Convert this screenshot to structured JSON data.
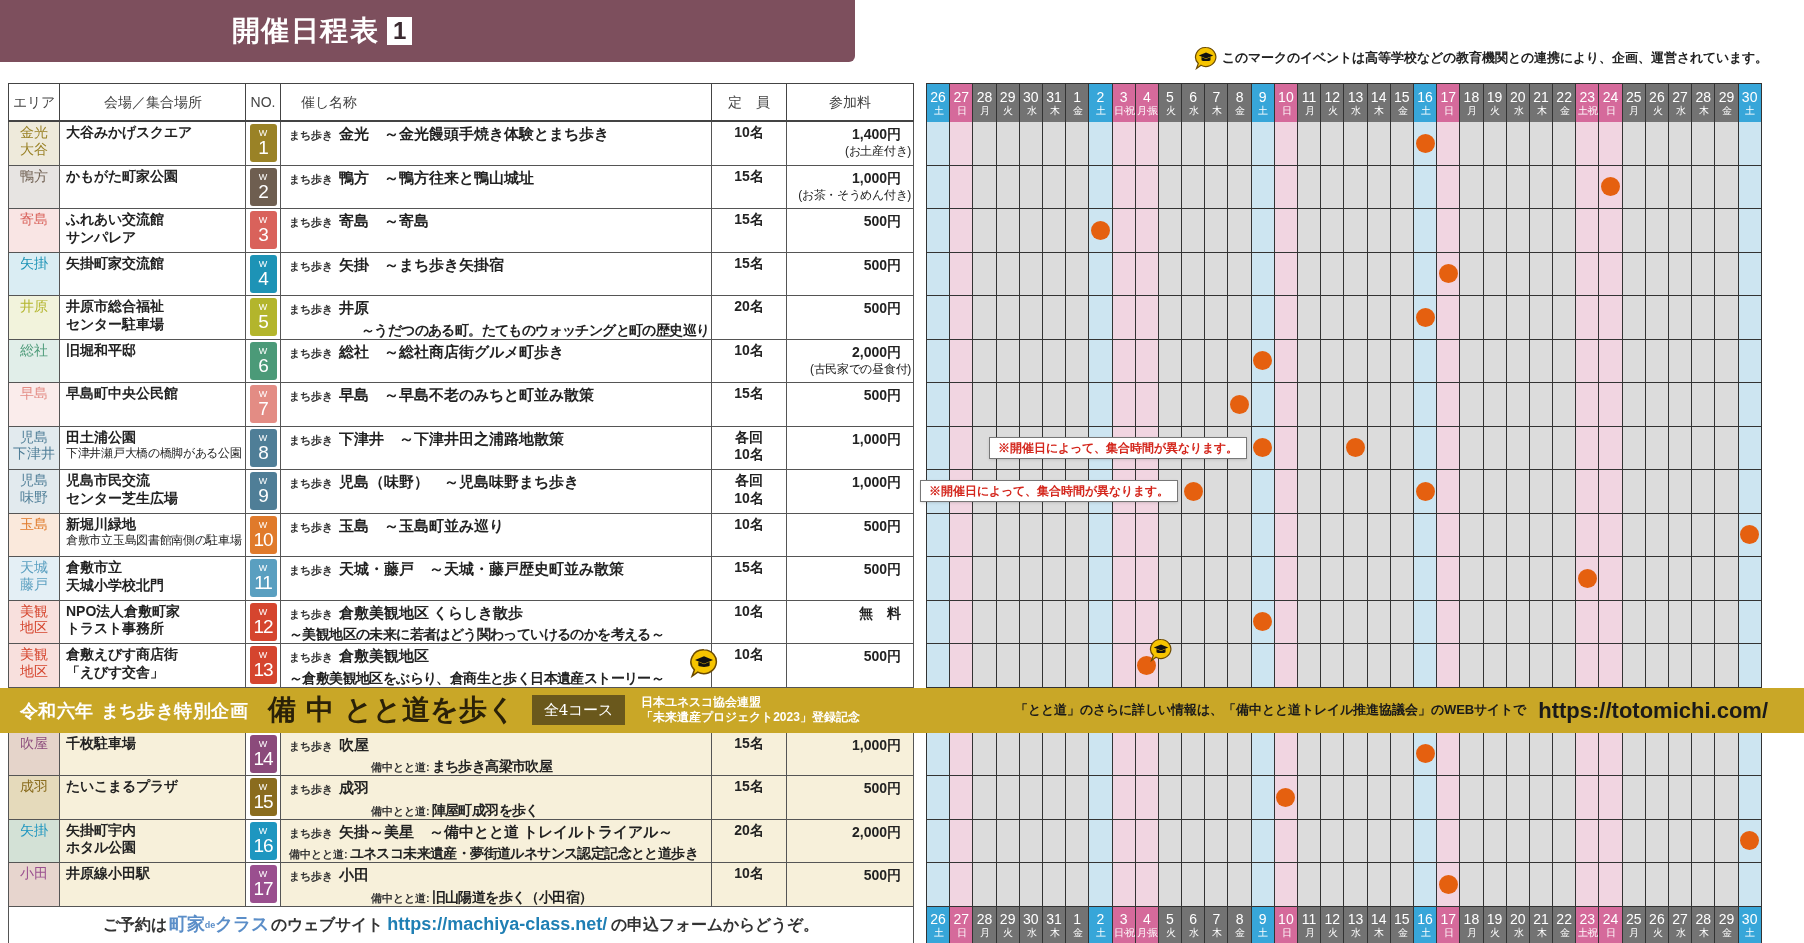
{
  "title": {
    "text": "開催日程表",
    "number": "1"
  },
  "legend": {
    "text": "このマークのイベントは高等学校などの教育機関との連携により、企画、運営されています。"
  },
  "table": {
    "columns": [
      "エリア",
      "会場／集合場所",
      "NO.",
      "催し名称",
      "定　員",
      "参加料"
    ],
    "days": [
      {
        "day": "26",
        "weekday": "土",
        "kind": "saturday"
      },
      {
        "day": "27",
        "weekday": "日",
        "kind": "holiday"
      },
      {
        "day": "28",
        "weekday": "月",
        "kind": "weekday"
      },
      {
        "day": "29",
        "weekday": "火",
        "kind": "weekday"
      },
      {
        "day": "30",
        "weekday": "水",
        "kind": "weekday"
      },
      {
        "day": "31",
        "weekday": "木",
        "kind": "weekday"
      },
      {
        "day": "1",
        "weekday": "金",
        "kind": "weekday"
      },
      {
        "day": "2",
        "weekday": "土",
        "kind": "saturday"
      },
      {
        "day": "3",
        "weekday": "日·祝",
        "kind": "holiday"
      },
      {
        "day": "4",
        "weekday": "月·振",
        "kind": "holiday"
      },
      {
        "day": "5",
        "weekday": "火",
        "kind": "weekday"
      },
      {
        "day": "6",
        "weekday": "水",
        "kind": "weekday"
      },
      {
        "day": "7",
        "weekday": "木",
        "kind": "weekday"
      },
      {
        "day": "8",
        "weekday": "金",
        "kind": "weekday"
      },
      {
        "day": "9",
        "weekday": "土",
        "kind": "saturday"
      },
      {
        "day": "10",
        "weekday": "日",
        "kind": "holiday"
      },
      {
        "day": "11",
        "weekday": "月",
        "kind": "weekday"
      },
      {
        "day": "12",
        "weekday": "火",
        "kind": "weekday"
      },
      {
        "day": "13",
        "weekday": "水",
        "kind": "weekday"
      },
      {
        "day": "14",
        "weekday": "木",
        "kind": "weekday"
      },
      {
        "day": "15",
        "weekday": "金",
        "kind": "weekday"
      },
      {
        "day": "16",
        "weekday": "土",
        "kind": "saturday"
      },
      {
        "day": "17",
        "weekday": "日",
        "kind": "holiday"
      },
      {
        "day": "18",
        "weekday": "月",
        "kind": "weekday"
      },
      {
        "day": "19",
        "weekday": "火",
        "kind": "weekday"
      },
      {
        "day": "20",
        "weekday": "水",
        "kind": "weekday"
      },
      {
        "day": "21",
        "weekday": "木",
        "kind": "weekday"
      },
      {
        "day": "22",
        "weekday": "金",
        "kind": "weekday"
      },
      {
        "day": "23",
        "weekday": "土·祝",
        "kind": "holiday"
      },
      {
        "day": "24",
        "weekday": "日",
        "kind": "holiday"
      },
      {
        "day": "25",
        "weekday": "月",
        "kind": "weekday"
      },
      {
        "day": "26",
        "weekday": "火",
        "kind": "weekday"
      },
      {
        "day": "27",
        "weekday": "水",
        "kind": "weekday"
      },
      {
        "day": "28",
        "weekday": "木",
        "kind": "weekday"
      },
      {
        "day": "29",
        "weekday": "金",
        "kind": "weekday"
      },
      {
        "day": "30",
        "weekday": "土",
        "kind": "saturday"
      }
    ],
    "footer_days": [
      {
        "day": "26",
        "weekday": "土",
        "kind": "saturday"
      },
      {
        "day": "27",
        "weekday": "日",
        "kind": "holiday"
      },
      {
        "day": "28",
        "weekday": "月",
        "kind": "weekday"
      },
      {
        "day": "29",
        "weekday": "火",
        "kind": "weekday"
      },
      {
        "day": "30",
        "weekday": "水",
        "kind": "weekday"
      },
      {
        "day": "31",
        "weekday": "木",
        "kind": "weekday"
      },
      {
        "day": "1",
        "weekday": "金",
        "kind": "weekday"
      },
      {
        "day": "2",
        "weekday": "土",
        "kind": "saturday"
      },
      {
        "day": "3",
        "weekday": "日·祝",
        "kind": "holiday"
      },
      {
        "day": "4",
        "weekday": "月·振",
        "kind": "holiday"
      },
      {
        "day": "5",
        "weekday": "火",
        "kind": "weekday"
      },
      {
        "day": "6",
        "weekday": "水",
        "kind": "weekday"
      },
      {
        "day": "7",
        "weekday": "木",
        "kind": "weekday"
      },
      {
        "day": "8",
        "weekday": "金",
        "kind": "weekday"
      },
      {
        "day": "9",
        "weekday": "土",
        "kind": "saturday"
      },
      {
        "day": "10",
        "weekday": "日",
        "kind": "holiday"
      },
      {
        "day": "11",
        "weekday": "月",
        "kind": "weekday"
      },
      {
        "day": "12",
        "weekday": "火",
        "kind": "weekday"
      },
      {
        "day": "13",
        "weekday": "水",
        "kind": "weekday"
      },
      {
        "day": "14",
        "weekday": "木",
        "kind": "weekday"
      },
      {
        "day": "15",
        "weekday": "金",
        "kind": "weekday"
      },
      {
        "day": "16",
        "weekday": "土",
        "kind": "saturday"
      },
      {
        "day": "17",
        "weekday": "日",
        "kind": "holiday"
      },
      {
        "day": "18",
        "weekday": "月",
        "kind": "weekday"
      },
      {
        "day": "19",
        "weekday": "火",
        "kind": "weekday"
      },
      {
        "day": "20",
        "weekday": "水",
        "kind": "weekday"
      },
      {
        "day": "21",
        "weekday": "木",
        "kind": "weekday"
      },
      {
        "day": "22",
        "weekday": "金",
        "kind": "weekday"
      },
      {
        "day": "23",
        "weekday": "土·祝",
        "kind": "holiday"
      },
      {
        "day": "24",
        "weekday": "日",
        "kind": "holiday"
      },
      {
        "day": "25",
        "weekday": "月",
        "kind": "weekday"
      },
      {
        "day": "26",
        "weekday": "火",
        "kind": "weekday"
      },
      {
        "day": "27",
        "weekday": "水",
        "kind": "weekday"
      },
      {
        "day": "28",
        "weekday": "木",
        "kind": "weekday"
      },
      {
        "day": "29",
        "weekday": "金",
        "kind": "weekday"
      },
      {
        "day": "30",
        "weekday": "土",
        "kind": "saturday"
      }
    ],
    "rows": [
      {
        "area": [
          "金光",
          "大谷"
        ],
        "color": "#9a8226",
        "venue": [
          "大谷みかげスクエア"
        ],
        "badge_letter": "W",
        "no": "1",
        "prefix": "まち歩き",
        "title": "金光　～金光饅頭手焼き体験とまち歩き",
        "capacity": [
          "10名"
        ],
        "fee": "1,400円",
        "fee_note": "(お土産付き)",
        "calendar": [
          false,
          false,
          false,
          false,
          false,
          false,
          false,
          false,
          false,
          false,
          false,
          false,
          false,
          false,
          false,
          false,
          false,
          false,
          false,
          false,
          false,
          true,
          false,
          false,
          false,
          false,
          false,
          false,
          false,
          false,
          false,
          false,
          false,
          false,
          false,
          false
        ]
      },
      {
        "area": [
          "鴨方"
        ],
        "color": "#6e5e50",
        "venue": [
          "かもがた町家公園"
        ],
        "badge_letter": "W",
        "no": "2",
        "prefix": "まち歩き",
        "title": "鴨方　～鴨方往来と鴨山城址",
        "capacity": [
          "15名"
        ],
        "fee": "1,000円",
        "fee_note": "(お茶・そうめん付き)",
        "calendar": [
          false,
          false,
          false,
          false,
          false,
          false,
          false,
          false,
          false,
          false,
          false,
          false,
          false,
          false,
          false,
          false,
          false,
          false,
          false,
          false,
          false,
          false,
          false,
          false,
          false,
          false,
          false,
          false,
          false,
          true,
          false,
          false,
          false,
          false,
          false,
          false
        ]
      },
      {
        "area": [
          "寄島"
        ],
        "color": "#d9625b",
        "venue": [
          "ふれあい交流館",
          "サンパレア"
        ],
        "badge_letter": "W",
        "no": "3",
        "prefix": "まち歩き",
        "title": "寄島　～寄島",
        "capacity": [
          "15名"
        ],
        "fee": "500円",
        "calendar": [
          false,
          false,
          false,
          false,
          false,
          false,
          false,
          true,
          false,
          false,
          false,
          false,
          false,
          false,
          false,
          false,
          false,
          false,
          false,
          false,
          false,
          false,
          false,
          false,
          false,
          false,
          false,
          false,
          false,
          false,
          false,
          false,
          false,
          false,
          false,
          false
        ]
      },
      {
        "area": [
          "矢掛"
        ],
        "color": "#1d93b6",
        "venue": [
          "矢掛町家交流館"
        ],
        "badge_letter": "W",
        "no": "4",
        "prefix": "まち歩き",
        "title": "矢掛　～まち歩き矢掛宿",
        "capacity": [
          "15名"
        ],
        "fee": "500円",
        "calendar": [
          false,
          false,
          false,
          false,
          false,
          false,
          false,
          false,
          false,
          false,
          false,
          false,
          false,
          false,
          false,
          false,
          false,
          false,
          false,
          false,
          false,
          false,
          true,
          false,
          false,
          false,
          false,
          false,
          false,
          false,
          false,
          false,
          false,
          false,
          false,
          false
        ]
      },
      {
        "area": [
          "井原"
        ],
        "color": "#b3b52c",
        "venue": [
          "井原市総合福祉",
          "センター駐車場"
        ],
        "badge_letter": "W",
        "no": "5",
        "prefix": "まち歩き",
        "title": "井原",
        "line2": "～うだつのある町。たてものウォッチングと町の歴史巡り",
        "line2_indent": true,
        "capacity": [
          "20名"
        ],
        "fee": "500円",
        "calendar": [
          false,
          false,
          false,
          false,
          false,
          false,
          false,
          false,
          false,
          false,
          false,
          false,
          false,
          false,
          false,
          false,
          false,
          false,
          false,
          false,
          false,
          true,
          false,
          false,
          false,
          false,
          false,
          false,
          false,
          false,
          false,
          false,
          false,
          false,
          false,
          false
        ]
      },
      {
        "area": [
          "総社"
        ],
        "color": "#4b9a78",
        "venue": [
          "旧堀和平邸"
        ],
        "badge_letter": "W",
        "no": "6",
        "prefix": "まち歩き",
        "title": "総社　～総社商店街グルメ町歩き",
        "capacity": [
          "10名"
        ],
        "fee": "2,000円",
        "fee_note": "(古民家での昼食付)",
        "calendar": [
          false,
          false,
          false,
          false,
          false,
          false,
          false,
          false,
          false,
          false,
          false,
          false,
          false,
          false,
          true,
          false,
          false,
          false,
          false,
          false,
          false,
          false,
          false,
          false,
          false,
          false,
          false,
          false,
          false,
          false,
          false,
          false,
          false,
          false,
          false,
          false
        ]
      },
      {
        "area": [
          "早島"
        ],
        "color": "#e38c84",
        "venue": [
          "早島町中央公民館"
        ],
        "badge_letter": "W",
        "no": "7",
        "prefix": "まち歩き",
        "title": "早島　～早島不老のみちと町並み散策",
        "capacity": [
          "15名"
        ],
        "fee": "500円",
        "calendar": [
          false,
          false,
          false,
          false,
          false,
          false,
          false,
          false,
          false,
          false,
          false,
          false,
          false,
          true,
          false,
          false,
          false,
          false,
          false,
          false,
          false,
          false,
          false,
          false,
          false,
          false,
          false,
          false,
          false,
          false,
          false,
          false,
          false,
          false,
          false,
          false
        ]
      },
      {
        "area": [
          "児島",
          "下津井"
        ],
        "color": "#4f7e97",
        "venue": [
          "田土浦公園"
        ],
        "venue_note": "下津井瀬戸大橋の橋脚がある公園",
        "badge_letter": "W",
        "no": "8",
        "prefix": "まち歩き",
        "title": "下津井　～下津井田之浦路地散策",
        "capacity": [
          "各回",
          "10名"
        ],
        "fee": "1,000円",
        "note": "※開催日によって、集合時間が異なります。",
        "calendar": [
          false,
          false,
          false,
          false,
          false,
          false,
          false,
          false,
          false,
          false,
          false,
          false,
          false,
          false,
          true,
          false,
          false,
          false,
          true,
          false,
          false,
          false,
          false,
          false,
          false,
          false,
          false,
          false,
          false,
          false,
          false,
          false,
          false,
          false,
          false,
          false
        ]
      },
      {
        "area": [
          "児島",
          "味野"
        ],
        "color": "#4f7e97",
        "venue": [
          "児島市民交流",
          "センター芝生広場"
        ],
        "badge_letter": "W",
        "no": "9",
        "prefix": "まち歩き",
        "title": "児島（味野）　～児島味野まち歩き",
        "capacity": [
          "各回",
          "10名"
        ],
        "fee": "1,000円",
        "note": "※開催日によって、集合時間が異なります。",
        "calendar": [
          false,
          false,
          false,
          false,
          false,
          false,
          false,
          false,
          false,
          false,
          false,
          true,
          false,
          false,
          false,
          false,
          false,
          false,
          false,
          false,
          false,
          true,
          false,
          false,
          false,
          false,
          false,
          false,
          false,
          false,
          false,
          false,
          false,
          false,
          false,
          false
        ]
      },
      {
        "area": [
          "玉島"
        ],
        "color": "#e07a2b",
        "venue": [
          "新堀川緑地"
        ],
        "venue_note": "倉敷市立玉島図書館南側の駐車場",
        "badge_letter": "W",
        "no": "10",
        "prefix": "まち歩き",
        "title": "玉島　～玉島町並み巡り",
        "capacity": [
          "10名"
        ],
        "fee": "500円",
        "calendar": [
          false,
          false,
          false,
          false,
          false,
          false,
          false,
          false,
          false,
          false,
          false,
          false,
          false,
          false,
          false,
          false,
          false,
          false,
          false,
          false,
          false,
          false,
          false,
          false,
          false,
          false,
          false,
          false,
          false,
          false,
          false,
          false,
          false,
          false,
          false,
          true
        ]
      },
      {
        "area": [
          "天城",
          "藤戸"
        ],
        "color": "#5a9fc0",
        "venue": [
          "倉敷市立",
          "天城小学校北門"
        ],
        "badge_letter": "W",
        "no": "11",
        "prefix": "まち歩き",
        "title": "天城・藤戸　～天城・藤戸歴史町並み散策",
        "capacity": [
          "15名"
        ],
        "fee": "500円",
        "calendar": [
          false,
          false,
          false,
          false,
          false,
          false,
          false,
          false,
          false,
          false,
          false,
          false,
          false,
          false,
          false,
          false,
          false,
          false,
          false,
          false,
          false,
          false,
          false,
          false,
          false,
          false,
          false,
          false,
          true,
          false,
          false,
          false,
          false,
          false,
          false,
          false
        ]
      },
      {
        "area": [
          "美観",
          "地区"
        ],
        "color": "#d5452e",
        "venue": [
          "NPO法人倉敷町家",
          "トラスト事務所"
        ],
        "badge_letter": "W",
        "no": "12",
        "prefix": "まち歩き",
        "title": "倉敷美観地区 くらしき散歩",
        "line2": "～美観地区の未来に若者はどう関わっていけるのかを考える～",
        "line2_indent": false,
        "capacity": [
          "10名"
        ],
        "fee": "無　料",
        "calendar": [
          false,
          false,
          false,
          false,
          false,
          false,
          false,
          false,
          false,
          false,
          false,
          false,
          false,
          false,
          true,
          false,
          false,
          false,
          false,
          false,
          false,
          false,
          false,
          false,
          false,
          false,
          false,
          false,
          false,
          false,
          false,
          false,
          false,
          false,
          false,
          false
        ]
      },
      {
        "area": [
          "美観",
          "地区"
        ],
        "color": "#d5452e",
        "venue": [
          "倉敷えびす商店街",
          "「えびす交舎」"
        ],
        "badge_letter": "W",
        "no": "13",
        "prefix": "まち歩き",
        "title": "倉敷美観地区",
        "line2": "～倉敷美観地区をぶらり、倉商生と歩く日本遺産ストーリー～",
        "line2_indent": false,
        "school": true,
        "capacity": [
          "10名"
        ],
        "fee": "500円",
        "calendar": [
          false,
          false,
          false,
          false,
          false,
          false,
          false,
          false,
          false,
          true,
          false,
          false,
          false,
          false,
          false,
          false,
          false,
          false,
          false,
          false,
          false,
          false,
          false,
          false,
          false,
          false,
          false,
          false,
          false,
          false,
          false,
          false,
          false,
          false,
          false,
          false
        ]
      }
    ],
    "banner": {
      "lead": "令和六年 まち歩き特別企画",
      "title": "備 中 とと道を歩く",
      "badge": "全4コース",
      "note": [
        "日本ユネスコ協会連盟",
        "「未来遺産プロジェクト2023」登録記念"
      ],
      "info": "「とと道」のさらに詳しい情報は、「備中とと道トレイル推進協議会」のWEBサイトで",
      "url": "https://totomichi.com/"
    },
    "special_rows": [
      {
        "area": [
          "吹屋"
        ],
        "color": "#8b4a7b",
        "venue": [
          "千枚駐車場"
        ],
        "badge_letter": "W",
        "no": "14",
        "prefix": "まち歩き",
        "title": "吹屋",
        "line2_prefix": "備中とと道:",
        "line2": "まち歩き高梁市吹屋",
        "line2_indent": true,
        "capacity": [
          "15名"
        ],
        "fee": "1,000円",
        "calendar": [
          false,
          false,
          false,
          false,
          false,
          false,
          false,
          false,
          false,
          false,
          false,
          false,
          false,
          false,
          false,
          false,
          false,
          false,
          false,
          false,
          false,
          true,
          false,
          false,
          false,
          false,
          false,
          false,
          false,
          false,
          false,
          false,
          false,
          false,
          false,
          false
        ]
      },
      {
        "area": [
          "成羽"
        ],
        "color": "#8a6c1e",
        "venue": [
          "たいこまるプラザ"
        ],
        "badge_letter": "W",
        "no": "15",
        "prefix": "まち歩き",
        "title": "成羽",
        "line2_prefix": "備中とと道:",
        "line2": "陣屋町成羽を歩く",
        "line2_indent": true,
        "capacity": [
          "15名"
        ],
        "fee": "500円",
        "calendar": [
          false,
          false,
          false,
          false,
          false,
          false,
          false,
          false,
          false,
          false,
          false,
          false,
          false,
          false,
          false,
          true,
          false,
          false,
          false,
          false,
          false,
          false,
          false,
          false,
          false,
          false,
          false,
          false,
          false,
          false,
          false,
          false,
          false,
          false,
          false,
          false
        ]
      },
      {
        "area": [
          "矢掛"
        ],
        "color": "#1e96c0",
        "venue": [
          "矢掛町宇内",
          "ホタル公園"
        ],
        "badge_letter": "W",
        "no": "16",
        "prefix": "まち歩き",
        "title": "矢掛～美星　～備中とと道 トレイルトライアル～",
        "line2_prefix": "備中とと道:",
        "line2": "ユネスコ未来遺産・夢街道ルネサンス認定記念とと道歩き",
        "line2_indent": false,
        "capacity": [
          "20名"
        ],
        "fee": "2,000円",
        "calendar": [
          false,
          false,
          false,
          false,
          false,
          false,
          false,
          false,
          false,
          false,
          false,
          false,
          false,
          false,
          false,
          false,
          false,
          false,
          false,
          false,
          false,
          false,
          false,
          false,
          false,
          false,
          false,
          false,
          false,
          false,
          false,
          false,
          false,
          false,
          false,
          true
        ]
      },
      {
        "area": [
          "小田"
        ],
        "color": "#9a4f8f",
        "venue": [
          "井原線小田駅"
        ],
        "badge_letter": "W",
        "no": "17",
        "prefix": "まち歩き",
        "title": "小田",
        "line2_prefix": "備中とと道:",
        "line2": "旧山陽道を歩く（小田宿）",
        "line2_indent": true,
        "capacity": [
          "10名"
        ],
        "fee": "500円",
        "calendar": [
          false,
          false,
          false,
          false,
          false,
          false,
          false,
          false,
          false,
          false,
          false,
          false,
          false,
          false,
          false,
          false,
          false,
          false,
          false,
          false,
          false,
          false,
          true,
          false,
          false,
          false,
          false,
          false,
          false,
          false,
          false,
          false,
          false,
          false,
          false,
          false
        ]
      }
    ]
  },
  "footer": {
    "before": "ご予約は",
    "logo": [
      "町家",
      "de",
      "クラス"
    ],
    "middle": "のウェブサイト",
    "link": "https://machiya-class.net/",
    "after": "の申込フォームからどうぞ。"
  }
}
